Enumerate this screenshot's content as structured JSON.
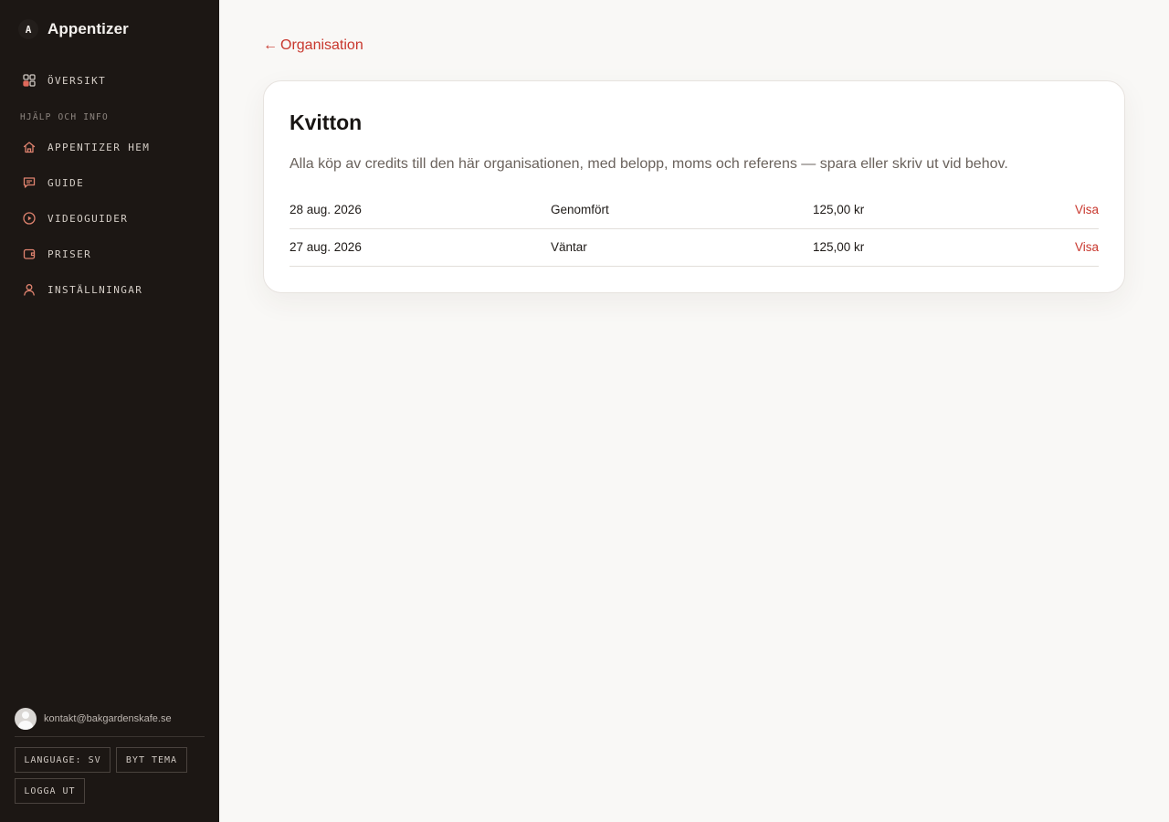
{
  "app": {
    "brand_letter": "A",
    "brand_name": "Appentizer"
  },
  "sidebar": {
    "overview": {
      "label": "ÖVERSIKT",
      "icon": "grid-icon"
    },
    "section_label": "HJÄLP OCH INFO",
    "items": [
      {
        "label": "APPENTIZER HEM",
        "icon": "home-icon"
      },
      {
        "label": "GUIDE",
        "icon": "chat-icon"
      },
      {
        "label": "VIDEOGUIDER",
        "icon": "play-circle-icon"
      },
      {
        "label": "PRISER",
        "icon": "wallet-icon"
      },
      {
        "label": "INSTÄLLNINGAR",
        "icon": "user-icon"
      }
    ],
    "user_email": "kontakt@bakgardenskafe.se",
    "language_button": "LANGUAGE: SV",
    "theme_button": "BYT TEMA",
    "logout_button": "LOGGA UT"
  },
  "main": {
    "back_arrow": "←",
    "back_label": "Organisation",
    "title": "Kvitton",
    "description": "Alla köp av credits till den här organisationen, med belopp, moms och referens — spara eller skriv ut vid behov.",
    "receipts": [
      {
        "date": "28 aug. 2026",
        "status": "Genomfört",
        "amount": "125,00 kr",
        "action": "Visa"
      },
      {
        "date": "27 aug. 2026",
        "status": "Väntar",
        "amount": "125,00 kr",
        "action": "Visa"
      }
    ]
  },
  "colors": {
    "sidebar_bg": "#1c1714",
    "accent": "#c8372d",
    "page_bg": "#f9f8f6"
  }
}
